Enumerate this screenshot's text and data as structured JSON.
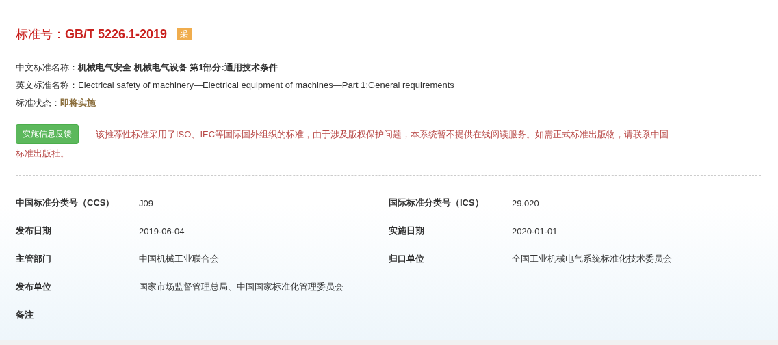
{
  "title": {
    "label": "标准号：",
    "code": "GB/T 5226.1-2019",
    "badge": "采"
  },
  "info": [
    {
      "label": "中文标准名称：",
      "value": "机械电气安全 机械电气设备 第1部分:通用技术条件",
      "kind": "bold"
    },
    {
      "label": "英文标准名称：",
      "value": "Electrical safety of machinery—Electrical equipment of machines—Part 1:General requirements",
      "kind": "plain"
    },
    {
      "label": "标准状态：",
      "value": "即将实施",
      "kind": "status"
    }
  ],
  "feedback_button": "实施信息反馈",
  "notice_lines": [
    "该推荐性标准采用了ISO、IEC等国际国外组织的标准，由于涉及版权保护问题，本系统暂不提供在线阅读服务。如需正式标准出版物，请联系中国",
    "标准出版社。"
  ],
  "table": {
    "rows": [
      [
        {
          "label": "中国标准分类号（CCS）",
          "value": "J09"
        },
        {
          "label": "国际标准分类号（ICS）",
          "value": "29.020"
        }
      ],
      [
        {
          "label": "发布日期",
          "value": "2019-06-04"
        },
        {
          "label": "实施日期",
          "value": "2020-01-01"
        }
      ],
      [
        {
          "label": "主管部门",
          "value": "中国机械工业联合会"
        },
        {
          "label": "归口单位",
          "value": "全国工业机械电气系统标准化技术委员会"
        }
      ],
      [
        {
          "label": "发布单位",
          "value": "国家市场监督管理总局、中国国家标准化管理委员会"
        }
      ],
      [
        {
          "label": "备注"
        }
      ]
    ]
  }
}
